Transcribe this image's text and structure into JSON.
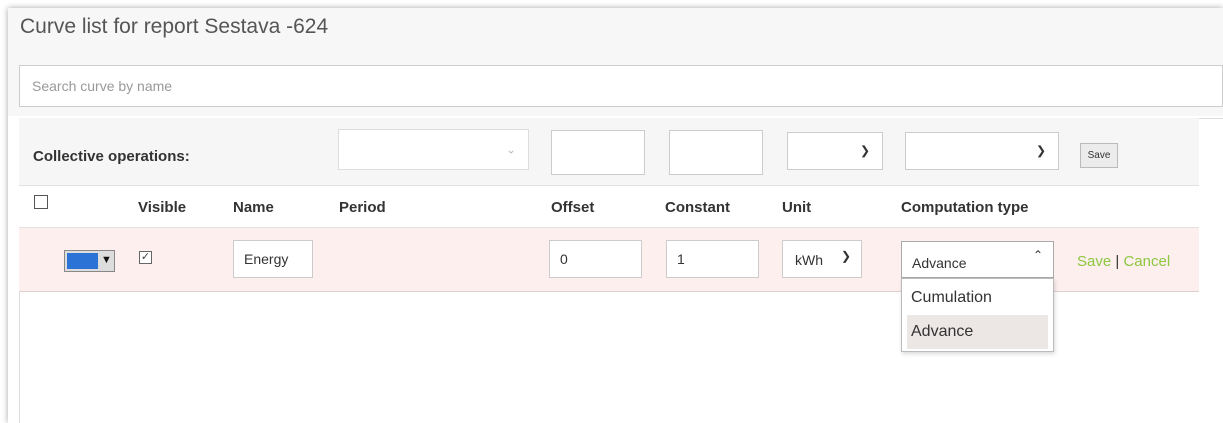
{
  "page": {
    "title": "Curve list for report Sestava -624"
  },
  "search": {
    "placeholder": "Search curve by name",
    "value": ""
  },
  "collective": {
    "label": "Collective operations:",
    "period_value": "",
    "offset_value": "",
    "constant_value": "",
    "unit_value": "",
    "computation_value": "",
    "save_label": "Save"
  },
  "columns": {
    "visible": "Visible",
    "name": "Name",
    "period": "Period",
    "offset": "Offset",
    "constant": "Constant",
    "unit": "Unit",
    "computation": "Computation type"
  },
  "row": {
    "color": "#2b74d6",
    "visible": true,
    "name": "Energy",
    "period": "",
    "offset": "0",
    "constant": "1",
    "unit": "kWh",
    "computation": "Advance",
    "save_label": "Save",
    "separator": "|",
    "cancel_label": "Cancel"
  },
  "computation_options": [
    "Cumulation",
    "Advance"
  ],
  "icons": {
    "chevron": "chevron-down-icon",
    "chevron_up": "chevron-up-icon",
    "color_arrow": "triangle-down-icon",
    "check": "checkmark-icon"
  },
  "colors": {
    "link": "#8dc63f",
    "row_highlight": "#fcefee",
    "swatch": "#2b74d6"
  }
}
